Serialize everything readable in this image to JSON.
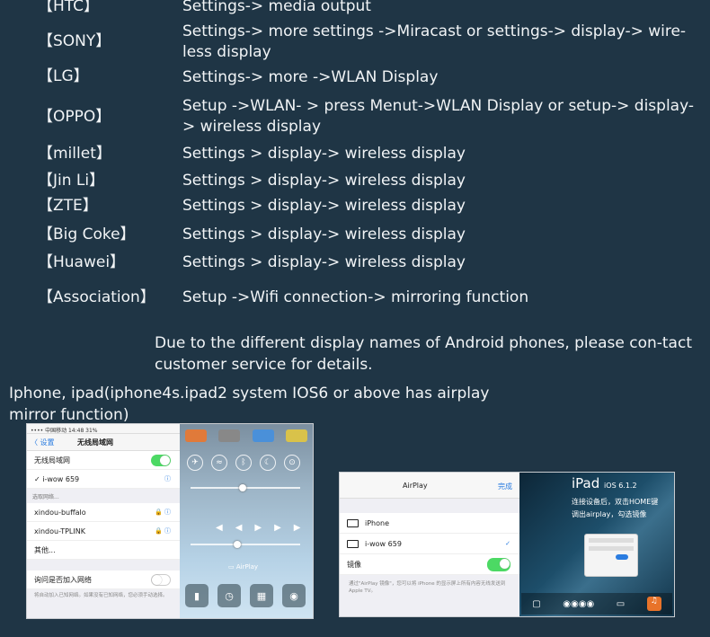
{
  "rows": [
    {
      "brand": "【HTC】",
      "step": "Settings-> media output"
    },
    {
      "brand": "【SONY】",
      "step": "Settings-> more settings ->Miracast or settings-> display-> wire-less display"
    },
    {
      "brand": "【LG】",
      "step": "Settings-> more ->WLAN Display"
    },
    {
      "brand": "【OPPO】",
      "step": "Setup ->WLAN- > press Menut->WLAN Display or setup-> display-> wireless display"
    },
    {
      "brand": "【millet】",
      "step": "Settings > display-> wireless display"
    },
    {
      "brand": "【Jin Li】",
      "step": "Settings > display-> wireless display"
    },
    {
      "brand": "【ZTE】",
      "step": "Settings > display-> wireless display"
    },
    {
      "brand": "【Big Coke】",
      "step": "Settings > display-> wireless display"
    },
    {
      "brand": "【Huawei】",
      "step": "Settings > display-> wireless display"
    },
    {
      "brand": "【Association】",
      "step": "Setup ->Wifi connection-> mirroring function"
    }
  ],
  "note": "Due to the different display names of Android phones, please con-tact customer service for details.",
  "ios_heading": "Iphone, ipad(iphone4s.ipad2 system IOS6 or above has airplay mirror function)",
  "wifi_screen": {
    "status": "•••• 中国移动  14:48  31%",
    "back": "〈 设置",
    "title": "无线局域网",
    "wlan_label": "无线局域网",
    "connected": "✓  i-wow 659",
    "section": "选取网络...",
    "net1": "xindou-buffalo",
    "net2": "xindou-TPLINK",
    "other": "其他...",
    "ask": "询问是否加入网络",
    "ask_note": "将自动加入已知网络。如果没有已知网络，您必须手动选择。",
    "accent": "#4cd964"
  },
  "control_center": {
    "airplay": "AirPlay"
  },
  "airplay_screen": {
    "title": "AirPlay",
    "done": "完成",
    "device1": "iPhone",
    "device2": "i-wow 659",
    "mirror": "镜像",
    "hint": "通过\"AirPlay 镜像\"，您可以将 iPhone 的显示屏上所有内容无线发送到 Apple TV。",
    "ipad_brand": "iPad",
    "ipad_version": "iOS 6.1.2",
    "ipad_line1": "连接设备后，双击HOME键",
    "ipad_line2": "调出airplay，勾选镜像"
  }
}
